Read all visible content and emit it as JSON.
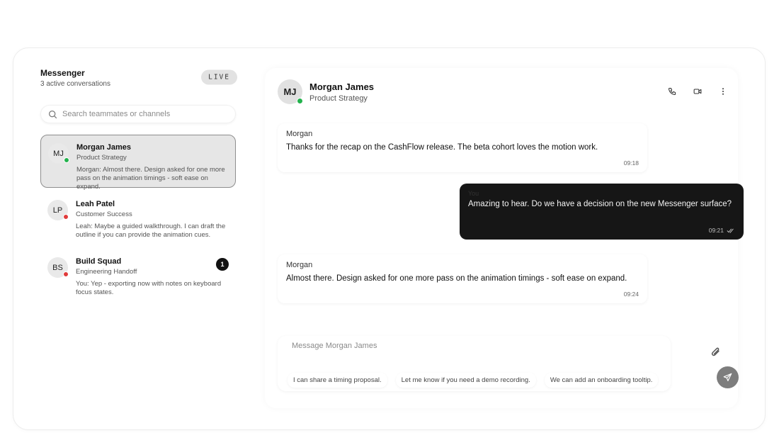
{
  "sidebar": {
    "title": "Messenger",
    "subtitle": "3 active conversations",
    "badge": "LIVE",
    "search_placeholder": "Search teammates or channels",
    "conversations": [
      {
        "initials": "MJ",
        "name": "Morgan James",
        "role": "Product Strategy",
        "preview": "Morgan: Almost there. Design asked for one more pass on the animation timings - soft ease on expand.",
        "status_color": "#22b24c",
        "active": true,
        "unread": ""
      },
      {
        "initials": "LP",
        "name": "Leah Patel",
        "role": "Customer Success",
        "preview": "Leah: Maybe a guided walkthrough. I can draft the outline if you can provide the animation cues.",
        "status_color": "#e03b3b",
        "active": false,
        "unread": ""
      },
      {
        "initials": "BS",
        "name": "Build Squad",
        "role": "Engineering Handoff",
        "preview": "You: Yep - exporting now with notes on keyboard focus states.",
        "status_color": "#e03b3b",
        "active": false,
        "unread": "1"
      }
    ]
  },
  "chat": {
    "initials": "MJ",
    "name": "Morgan James",
    "subtitle": "Product Strategy",
    "status_color": "#22b24c",
    "actions": [
      "phone-icon",
      "video-icon",
      "more-icon"
    ],
    "messages": [
      {
        "direction": "in",
        "sender": "Morgan",
        "text": "Thanks for the recap on the CashFlow release. The beta cohort loves the motion work.",
        "time": "09:18"
      },
      {
        "direction": "out",
        "sender": "You",
        "text": "Amazing to hear. Do we have a decision on the new Messenger surface?",
        "time": "09:21"
      },
      {
        "direction": "in",
        "sender": "Morgan",
        "text": "Almost there. Design asked for one more pass on the animation timings - soft ease on expand.",
        "time": "09:24"
      }
    ],
    "composer_placeholder": "Message Morgan James",
    "suggestions": [
      "I can share a timing proposal.",
      "Let me know if you need a demo recording.",
      "We can add an onboarding tooltip."
    ]
  }
}
